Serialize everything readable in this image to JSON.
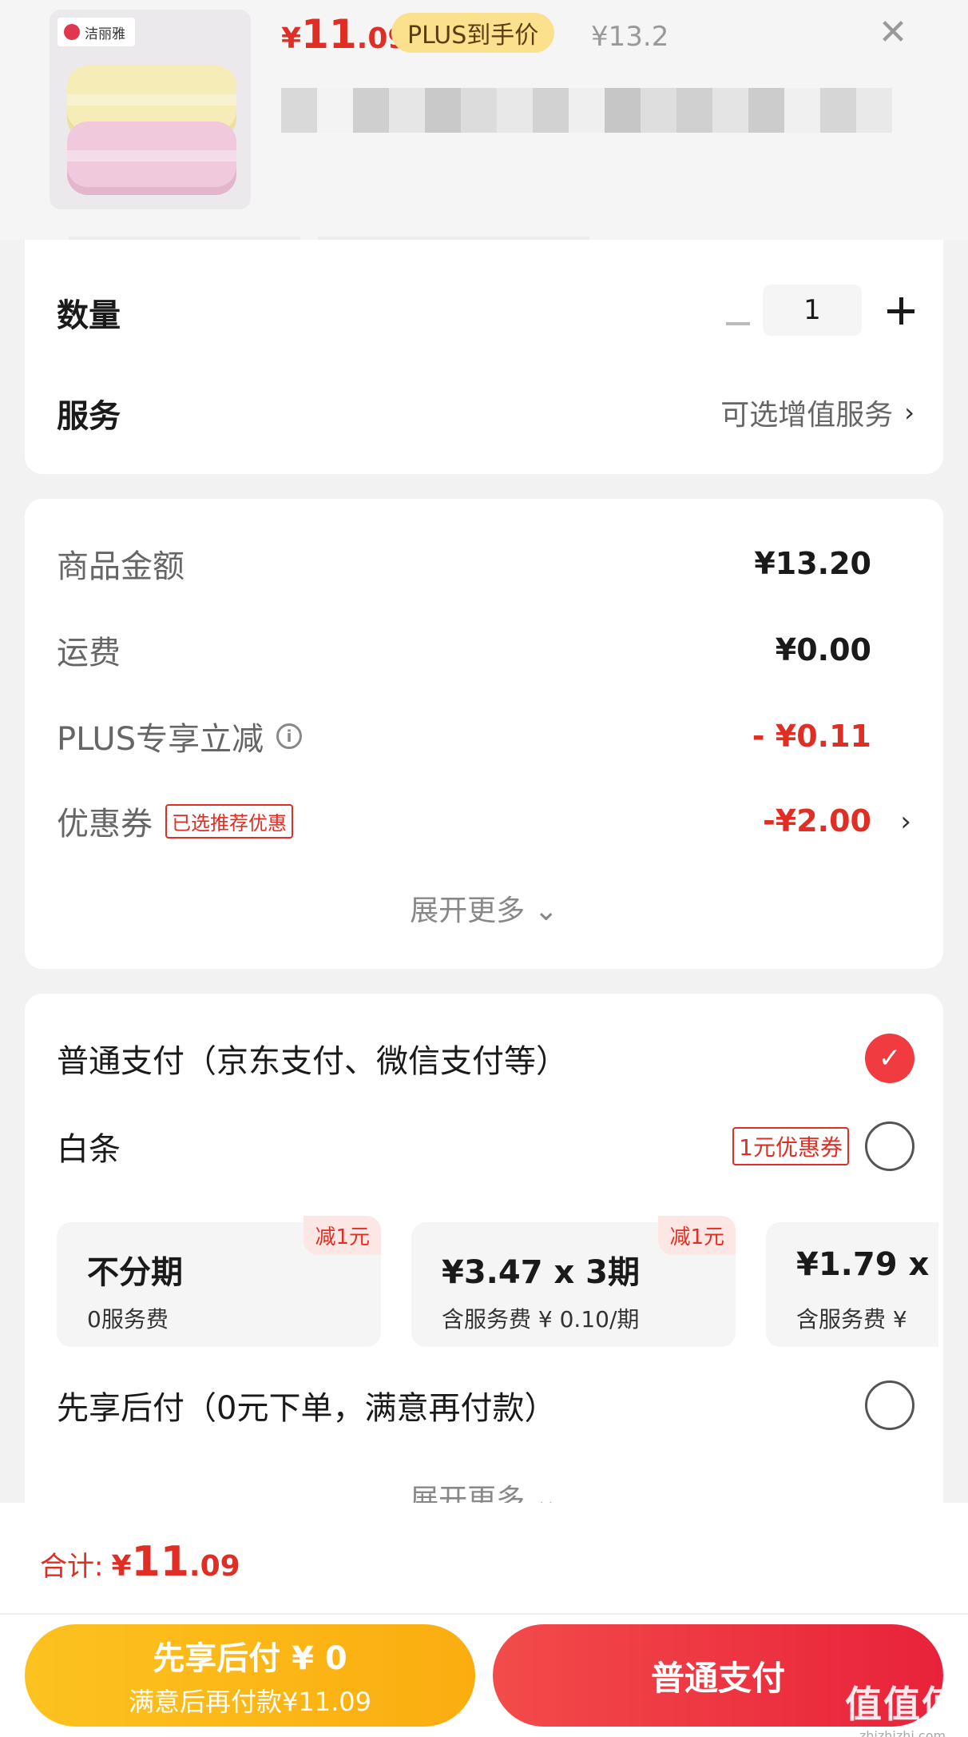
{
  "product": {
    "brand_logo": "洁丽雅",
    "price_currency": "¥",
    "price_int": "11",
    "price_dec": ".09",
    "plus_badge": "PLUS到手价",
    "original_price": "¥13.2",
    "close_icon": "close-icon"
  },
  "quantity": {
    "label": "数量",
    "value": "1"
  },
  "service": {
    "label": "服务",
    "link_text": "可选增值服务"
  },
  "fees": {
    "items": [
      {
        "label": "商品金额",
        "value": "¥13.20"
      },
      {
        "label": "运费",
        "value": "¥0.00"
      },
      {
        "label": "PLUS专享立减",
        "value": "- ¥0.11"
      },
      {
        "label": "优惠券",
        "tag": "已选推荐优惠",
        "value": "-¥2.00"
      }
    ],
    "expand_more": "展开更多"
  },
  "payment": {
    "normal_label": "普通支付（京东支付、微信支付等）",
    "baitiao_label": "白条",
    "baitiao_coupon": "1元优惠券",
    "plans": [
      {
        "title": "不分期",
        "sub": "0服务费",
        "ribbon": "减1元"
      },
      {
        "title": "¥3.47 x 3期",
        "sub": "含服务费 ¥ 0.10/期",
        "ribbon": "减1元"
      },
      {
        "title": "¥1.79 x",
        "sub": "含服务费 ¥",
        "ribbon": ""
      }
    ],
    "bnpl_label": "先享后付（0元下单，满意再付款）",
    "expand_more": "展开更多"
  },
  "bottom": {
    "total_label": "合计:",
    "total_currency": "¥",
    "total_int": "11",
    "total_dec": ".09",
    "bnpl_button_line1": "先享后付 ¥ 0",
    "bnpl_button_line2": "满意后再付款¥11.09",
    "normal_button": "普通支付"
  },
  "watermark": {
    "big": "值值值",
    "small": "zhizhizhi.com"
  },
  "colors": {
    "accent_red": "#e02e24",
    "plus_gold": "#fbe08e",
    "bnpl_yellow": "#fcc21f",
    "pay_red": "#f03b40"
  }
}
